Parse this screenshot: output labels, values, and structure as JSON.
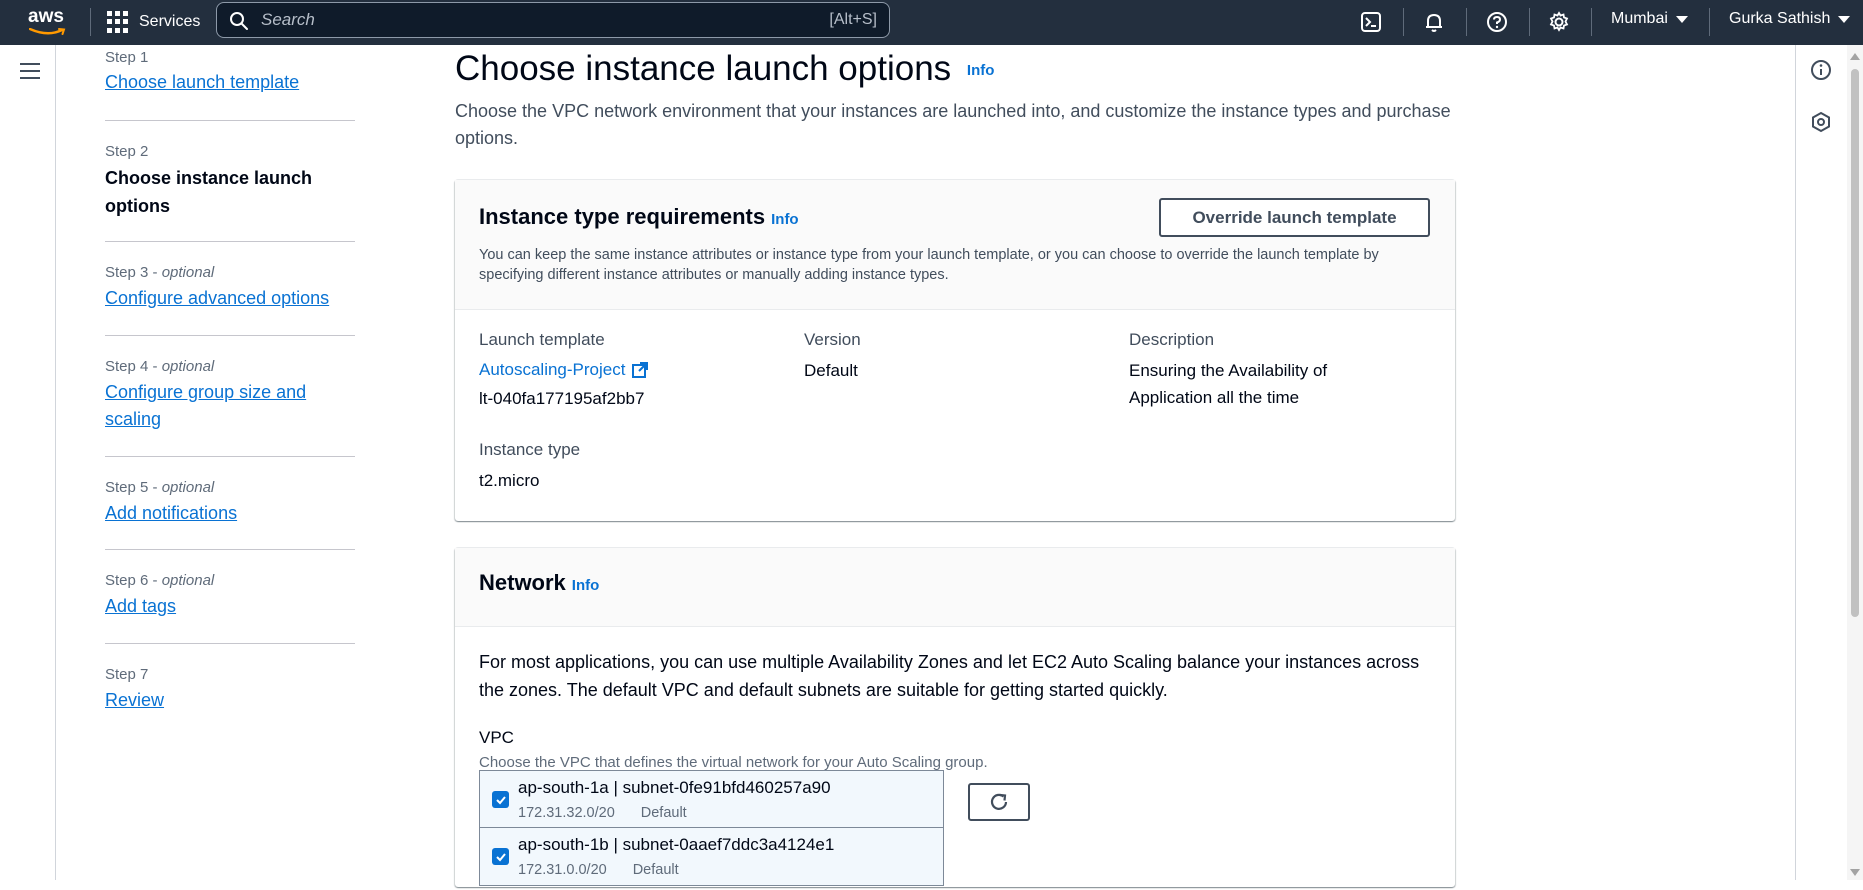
{
  "topnav": {
    "logo_text": "aws",
    "services_label": "Services",
    "search_placeholder": "Search",
    "search_shortcut": "[Alt+S]",
    "region": "Mumbai",
    "user": "Gurka Sathish",
    "icons": [
      "cloudshell-icon",
      "notifications-bell-icon",
      "help-icon",
      "settings-gear-icon"
    ]
  },
  "steps": [
    {
      "label": "Step 1",
      "optional": "",
      "title": "Choose launch template",
      "state": "link"
    },
    {
      "label": "Step 2",
      "optional": "",
      "title": "Choose instance launch options",
      "state": "current"
    },
    {
      "label": "Step 3 - ",
      "optional": "optional",
      "title": "Configure advanced options",
      "state": "link"
    },
    {
      "label": "Step 4 - ",
      "optional": "optional",
      "title": "Configure group size and scaling",
      "state": "link"
    },
    {
      "label": "Step 5 - ",
      "optional": "optional",
      "title": "Add notifications",
      "state": "link"
    },
    {
      "label": "Step 6 - ",
      "optional": "optional",
      "title": "Add tags",
      "state": "link"
    },
    {
      "label": "Step 7",
      "optional": "",
      "title": "Review",
      "state": "link"
    }
  ],
  "page": {
    "title": "Choose instance launch options",
    "info": "Info",
    "description": "Choose the VPC network environment that your instances are launched into, and customize the instance types and purchase options."
  },
  "instance_requirements": {
    "title": "Instance type requirements",
    "info": "Info",
    "override_button": "Override launch template",
    "description": "You can keep the same instance attributes or instance type from your launch template, or you can choose to override the launch template by specifying different instance attributes or manually adding instance types.",
    "launch_template_label": "Launch template",
    "launch_template_name": "Autoscaling-Project",
    "launch_template_id": "lt-040fa177195af2bb7",
    "version_label": "Version",
    "version_value": "Default",
    "description_label": "Description",
    "description_value_line1": "Ensuring the Availability of",
    "description_value_line2": "Application all the time",
    "instance_type_label": "Instance type",
    "instance_type_value": "t2.micro"
  },
  "network": {
    "title": "Network",
    "info": "Info",
    "body": "For most applications, you can use multiple Availability Zones and let EC2 Auto Scaling balance your instances across the zones. The default VPC and default subnets are suitable for getting started quickly.",
    "vpc_label": "VPC",
    "vpc_description": "Choose the VPC that defines the virtual network for your Auto Scaling group.",
    "subnets": [
      {
        "title": "ap-south-1a | subnet-0fe91bfd460257a90",
        "cidr": "172.31.32.0/20",
        "tag": "Default",
        "checked": true
      },
      {
        "title": "ap-south-1b | subnet-0aaef7ddc3a4124e1",
        "cidr": "172.31.0.0/20",
        "tag": "Default",
        "checked": true
      }
    ]
  },
  "colors": {
    "nav_bg": "#232f3e",
    "link": "#0972d3",
    "text": "#000716",
    "muted": "#414d5c"
  }
}
